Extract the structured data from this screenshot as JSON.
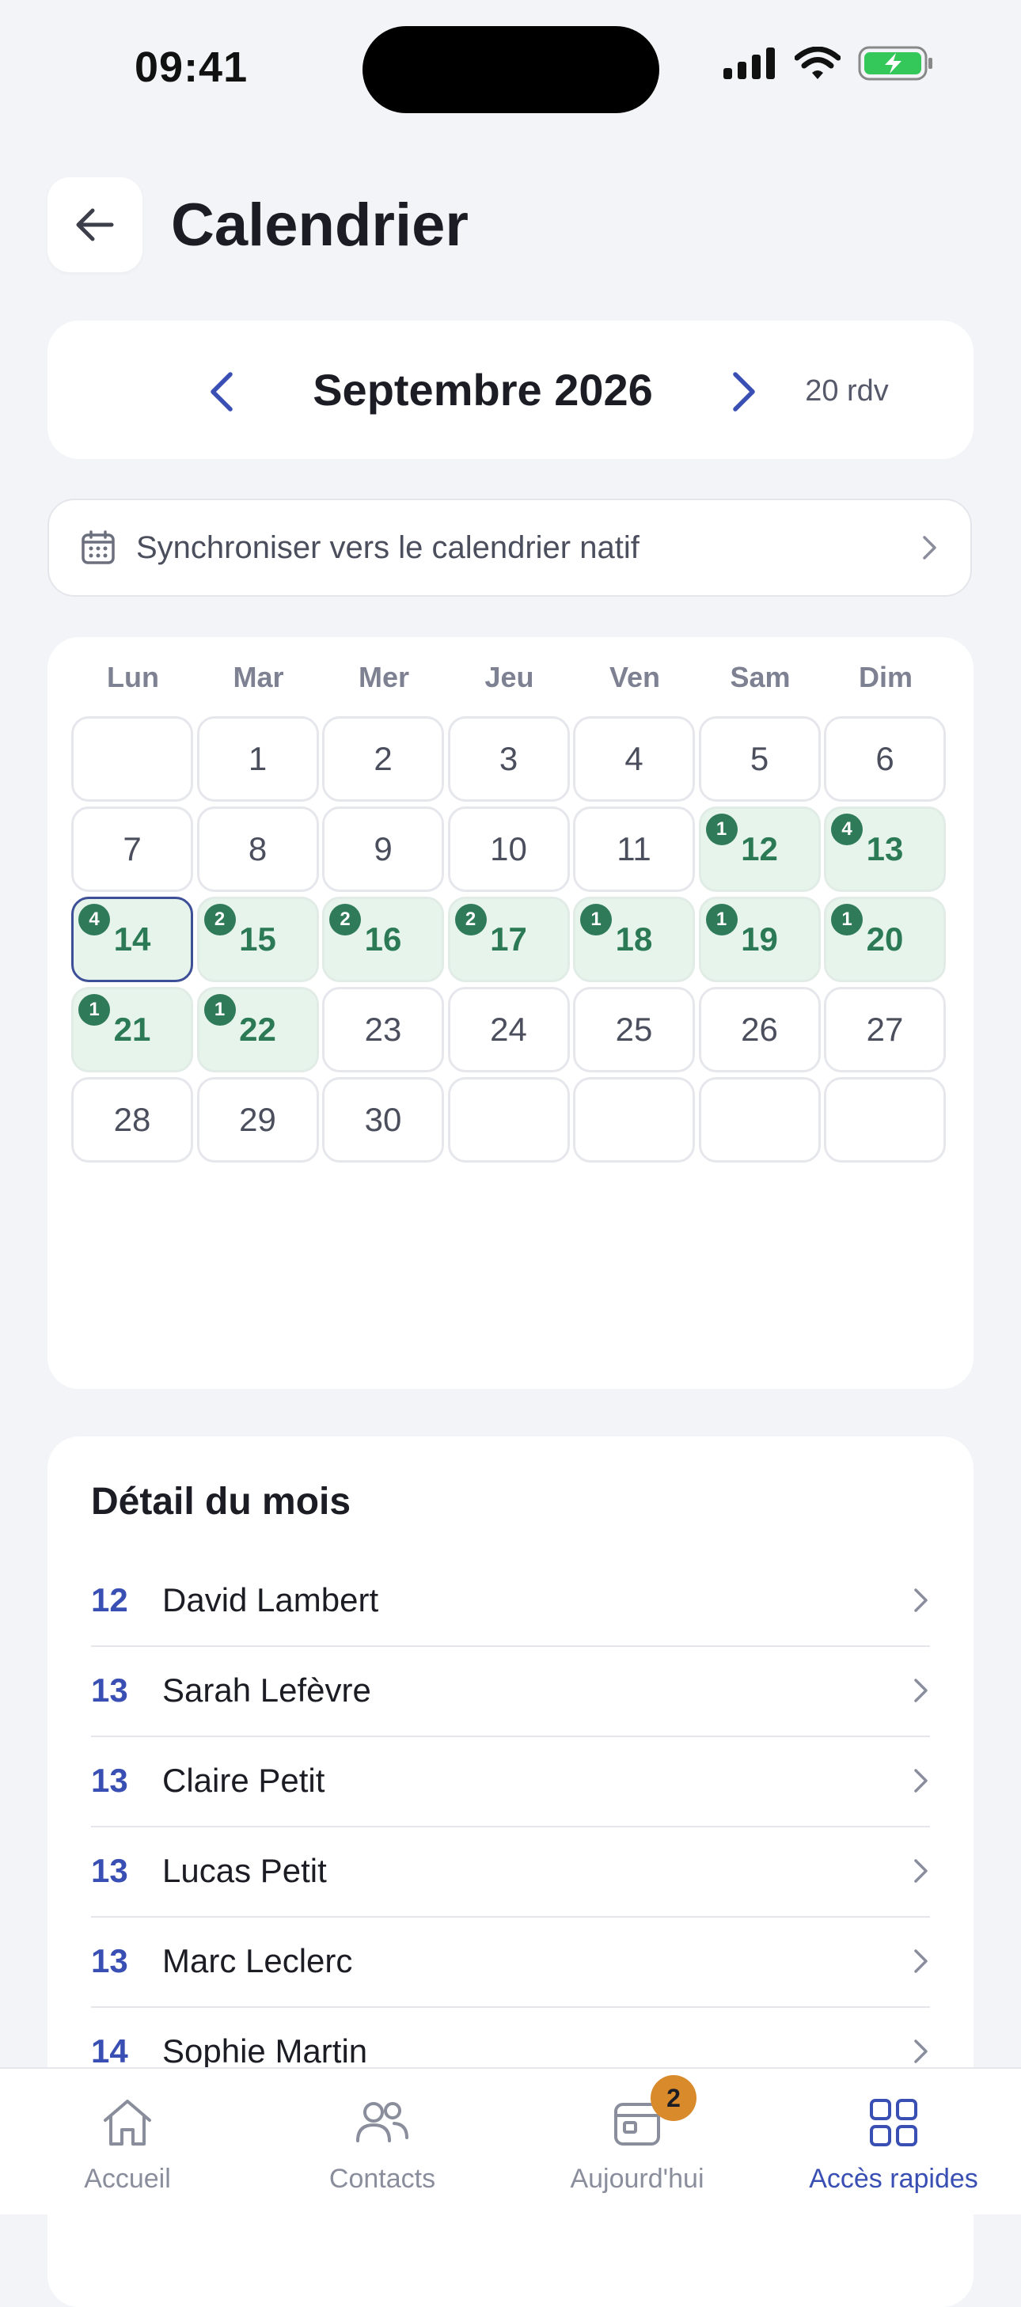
{
  "status": {
    "time": "09:41",
    "battery_color": "#34c759"
  },
  "header": {
    "title": "Calendrier"
  },
  "month": {
    "title": "Septembre 2026",
    "count": "20 rdv"
  },
  "sync": {
    "label": "Synchroniser vers le calendrier natif"
  },
  "calendar": {
    "weekdays": [
      "Lun",
      "Mar",
      "Mer",
      "Jeu",
      "Ven",
      "Sam",
      "Dim"
    ],
    "weeks": [
      [
        null,
        {
          "d": "1"
        },
        {
          "d": "2"
        },
        {
          "d": "3"
        },
        {
          "d": "4"
        },
        {
          "d": "5"
        },
        {
          "d": "6"
        }
      ],
      [
        {
          "d": "7"
        },
        {
          "d": "8"
        },
        {
          "d": "9"
        },
        {
          "d": "10"
        },
        {
          "d": "11"
        },
        {
          "d": "12",
          "n": "1"
        },
        {
          "d": "13",
          "n": "4"
        }
      ],
      [
        {
          "d": "14",
          "n": "4",
          "sel": true
        },
        {
          "d": "15",
          "n": "2"
        },
        {
          "d": "16",
          "n": "2"
        },
        {
          "d": "17",
          "n": "2"
        },
        {
          "d": "18",
          "n": "1"
        },
        {
          "d": "19",
          "n": "1"
        },
        {
          "d": "20",
          "n": "1"
        }
      ],
      [
        {
          "d": "21",
          "n": "1"
        },
        {
          "d": "22",
          "n": "1"
        },
        {
          "d": "23"
        },
        {
          "d": "24"
        },
        {
          "d": "25"
        },
        {
          "d": "26"
        },
        {
          "d": "27"
        }
      ],
      [
        {
          "d": "28"
        },
        {
          "d": "29"
        },
        {
          "d": "30"
        },
        null,
        null,
        null,
        null
      ]
    ]
  },
  "detail": {
    "title": "Détail du mois",
    "rows": [
      {
        "day": "12",
        "name": "David Lambert"
      },
      {
        "day": "13",
        "name": "Sarah Lefèvre"
      },
      {
        "day": "13",
        "name": "Claire Petit"
      },
      {
        "day": "13",
        "name": "Lucas Petit"
      },
      {
        "day": "13",
        "name": "Marc Leclerc"
      },
      {
        "day": "14",
        "name": "Sophie Martin"
      }
    ]
  },
  "tabs": [
    {
      "label": "Accueil",
      "icon": "home-icon"
    },
    {
      "label": "Contacts",
      "icon": "people-icon"
    },
    {
      "label": "Aujourd'hui",
      "icon": "calendar-today-icon",
      "badge": "2"
    },
    {
      "label": "Accès rapides",
      "icon": "grid-icon",
      "active": true
    }
  ],
  "colors": {
    "accent": "#3a4fb3",
    "event_bg": "#e7f4ec",
    "event_text": "#2b7a55",
    "badge": "#2f7a58",
    "tab_badge": "#d98a2b"
  }
}
